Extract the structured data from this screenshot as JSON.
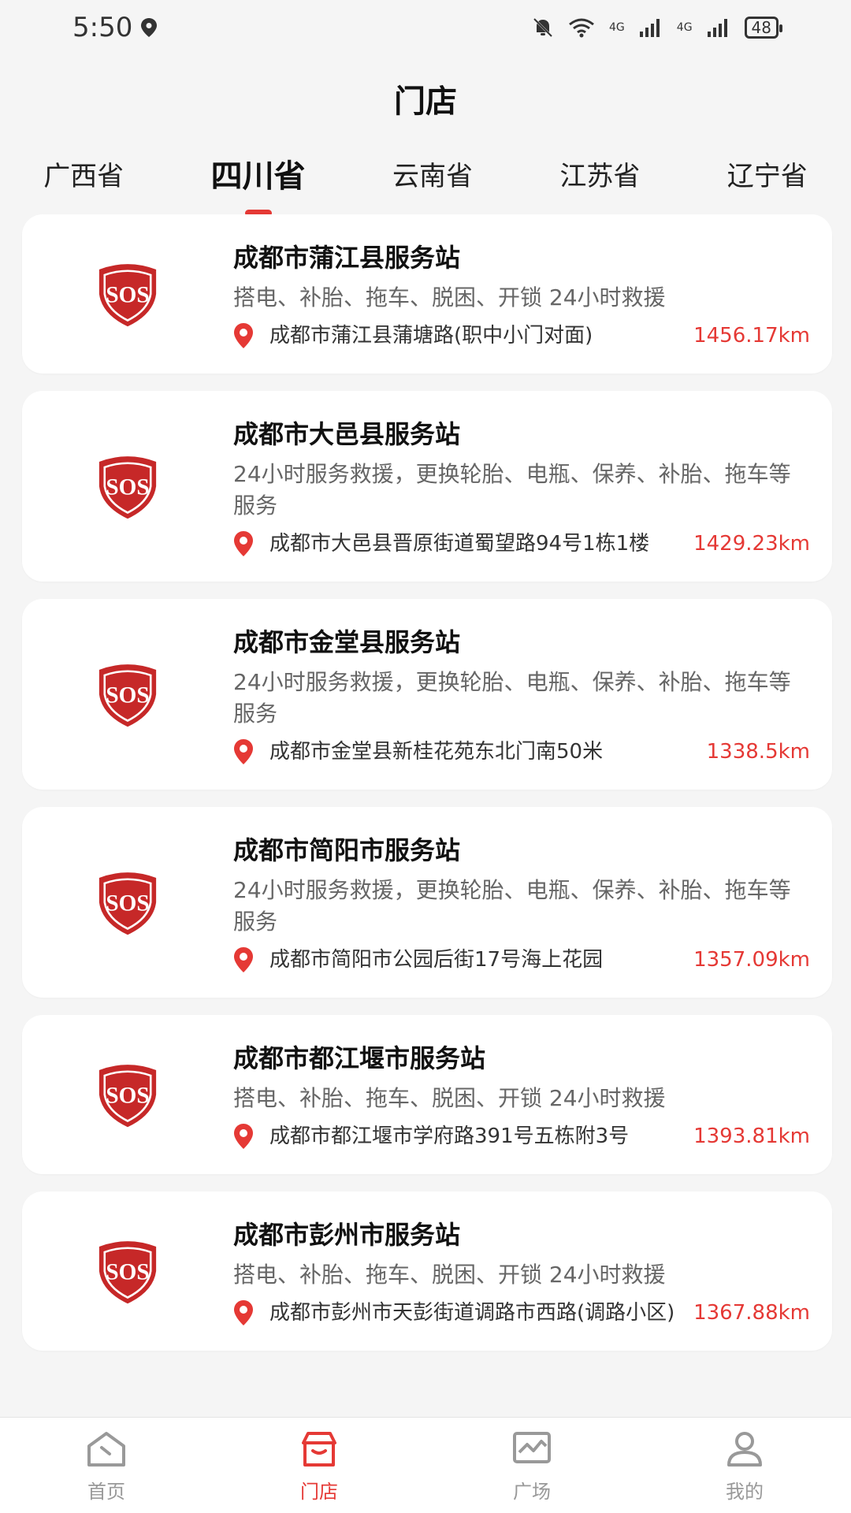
{
  "status_bar": {
    "time": "5:50",
    "battery": "48",
    "signal1": "4G",
    "signal2": "4G"
  },
  "header": {
    "title": "门店"
  },
  "tabs": [
    {
      "label": "广西省",
      "active": false
    },
    {
      "label": "四川省",
      "active": true
    },
    {
      "label": "云南省",
      "active": false
    },
    {
      "label": "江苏省",
      "active": false
    },
    {
      "label": "辽宁省",
      "active": false
    }
  ],
  "stations": [
    {
      "name": "成都市蒲江县服务站",
      "services": "搭电、补胎、拖车、脱困、开锁 24小时救援",
      "address": "成都市蒲江县蒲塘路(职中小门对面)",
      "distance": "1456.17km"
    },
    {
      "name": "成都市大邑县服务站",
      "services": "24小时服务救援，更换轮胎、电瓶、保养、补胎、拖车等服务",
      "address": "成都市大邑县晋原街道蜀望路94号1栋1楼",
      "distance": "1429.23km"
    },
    {
      "name": "成都市金堂县服务站",
      "services": "24小时服务救援，更换轮胎、电瓶、保养、补胎、拖车等服务",
      "address": "成都市金堂县新桂花苑东北门南50米",
      "distance": "1338.5km"
    },
    {
      "name": "成都市简阳市服务站",
      "services": "24小时服务救援，更换轮胎、电瓶、保养、补胎、拖车等服务",
      "address": "成都市简阳市公园后街17号海上花园",
      "distance": "1357.09km"
    },
    {
      "name": "成都市都江堰市服务站",
      "services": "搭电、补胎、拖车、脱困、开锁 24小时救援",
      "address": "成都市都江堰市学府路391号五栋附3号",
      "distance": "1393.81km"
    },
    {
      "name": "成都市彭州市服务站",
      "services": "搭电、补胎、拖车、脱困、开锁 24小时救援",
      "address": "成都市彭州市天彭街道调路市西路(调路小区)",
      "distance": "1367.88km"
    }
  ],
  "logo_text": "SOS",
  "bottom_nav": [
    {
      "label": "首页",
      "icon": "home-icon",
      "active": false
    },
    {
      "label": "门店",
      "icon": "store-icon",
      "active": true
    },
    {
      "label": "广场",
      "icon": "square-icon",
      "active": false
    },
    {
      "label": "我的",
      "icon": "profile-icon",
      "active": false
    }
  ],
  "colors": {
    "accent": "#e53935",
    "logo_red": "#c62828",
    "background": "#f5f5f5"
  }
}
